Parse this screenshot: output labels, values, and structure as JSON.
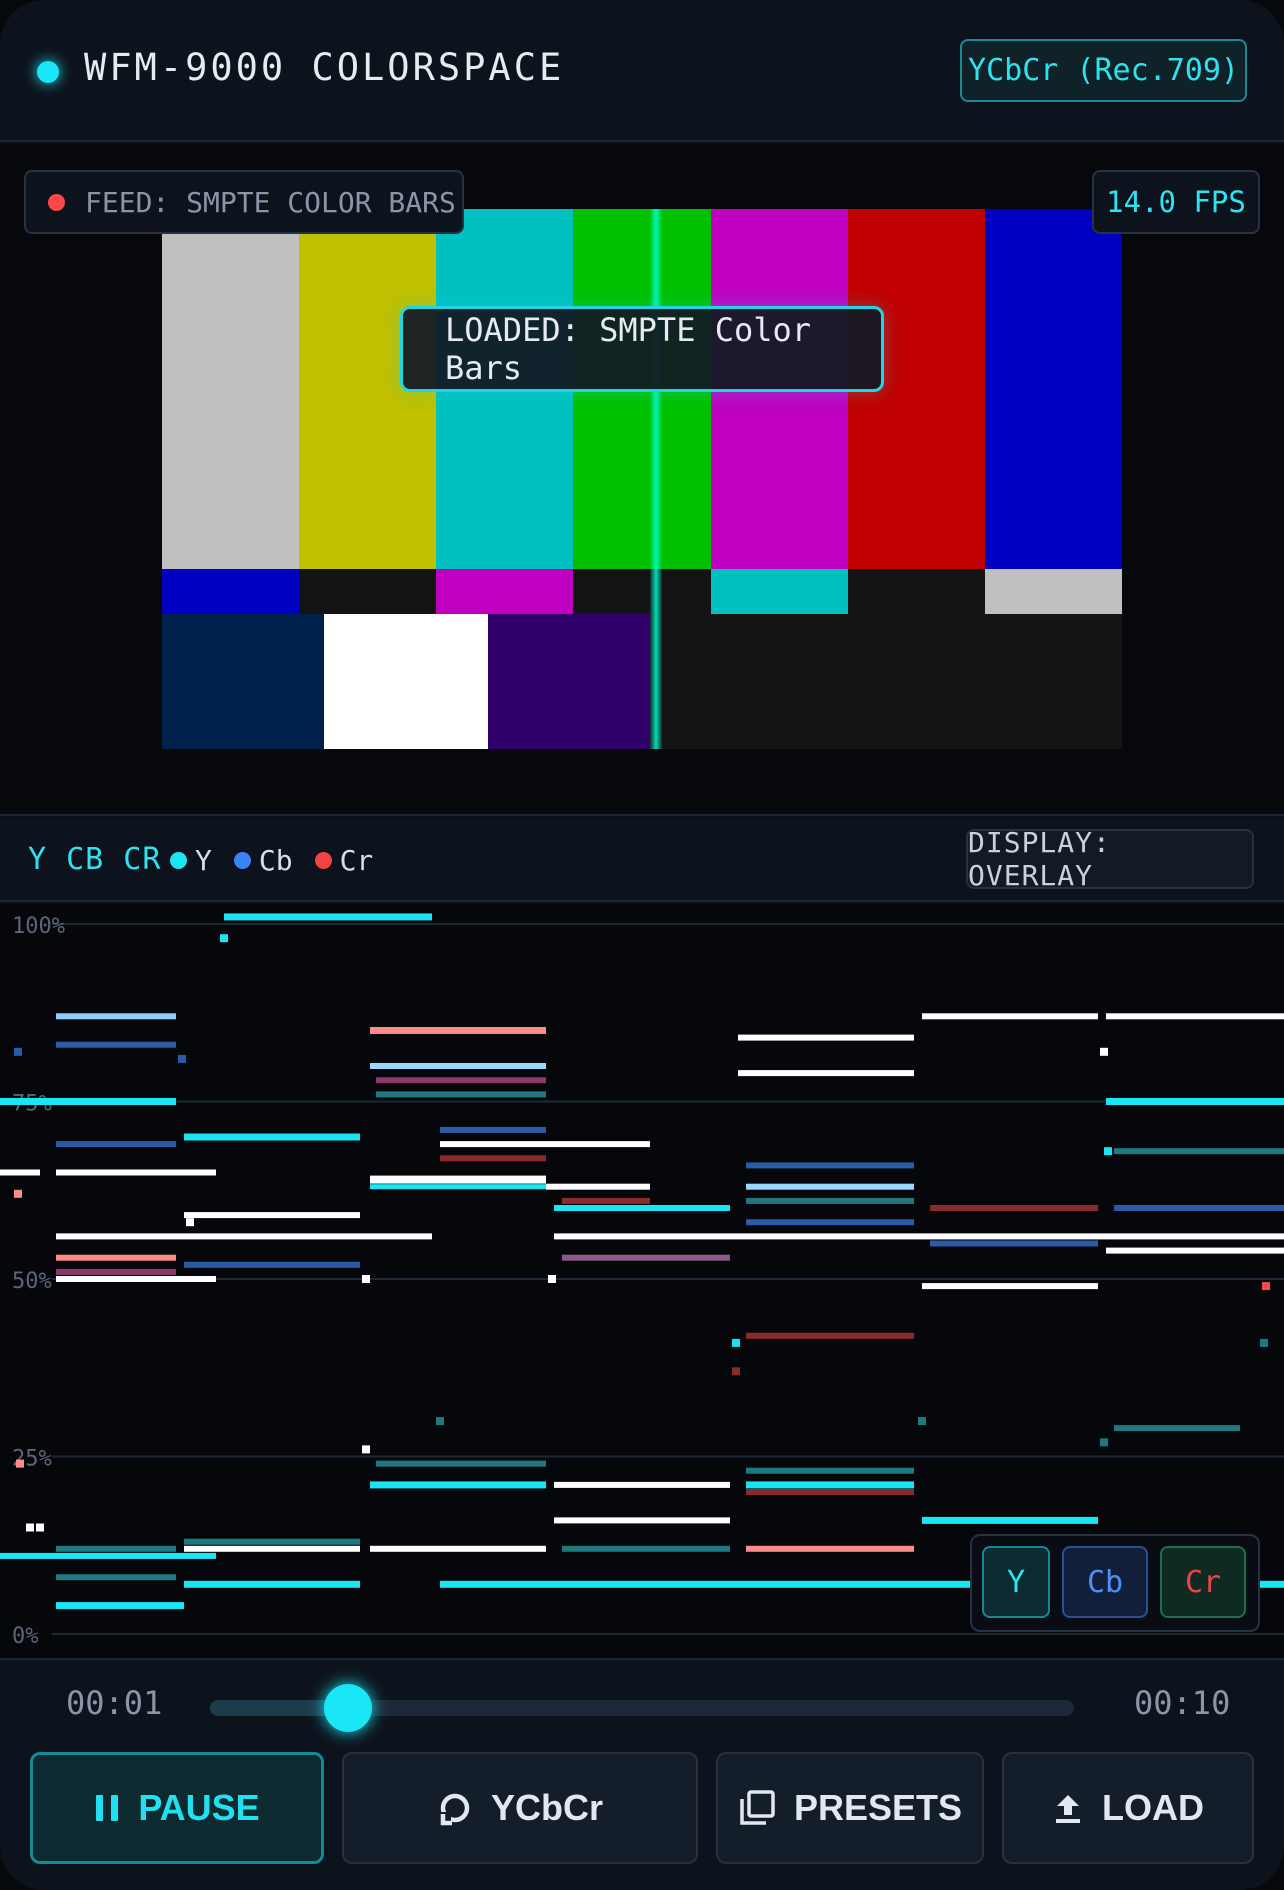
{
  "header": {
    "title": "WFM-9000 COLORSPACE",
    "mode_badge": "YCbCr (Rec.709)"
  },
  "video": {
    "feed_label": "FEED: SMPTE COLOR BARS",
    "fps_label": "14.0 FPS",
    "toast": "LOADED: SMPTE Color Bars",
    "bars_top": [
      "#c0c0c0",
      "#c0c000",
      "#00c0c0",
      "#00c000",
      "#c000c0",
      "#c00000",
      "#0000c0"
    ],
    "bars_mid": [
      "#0000c0",
      "#131313",
      "#c000c0",
      "#131313",
      "#00c0c0",
      "#131313",
      "#c0c0c0"
    ],
    "bars_bottom": [
      "#00214c",
      "#ffffff",
      "#32006a",
      "#131313"
    ]
  },
  "scope": {
    "label": "Y CB CR",
    "legend": [
      {
        "name": "Y",
        "color": "#18e6f5"
      },
      {
        "name": "Cb",
        "color": "#3b82f6"
      },
      {
        "name": "Cr",
        "color": "#ef4444"
      }
    ],
    "display_mode": "DISPLAY: OVERLAY",
    "gridlines": [
      "100%",
      "75%",
      "50%",
      "25%",
      "0%"
    ],
    "channel_buttons": [
      {
        "label": "Y",
        "color": "#2fe2f0"
      },
      {
        "label": "Cb",
        "color": "#4f8ff7"
      },
      {
        "label": "Cr",
        "color": "#ef4444"
      }
    ]
  },
  "timeline": {
    "current": "00:01",
    "total": "00:10",
    "progress": 0.16
  },
  "buttons": {
    "pause": "PAUSE",
    "colorspace": "YCbCr",
    "presets": "PRESETS",
    "load": "LOAD"
  }
}
